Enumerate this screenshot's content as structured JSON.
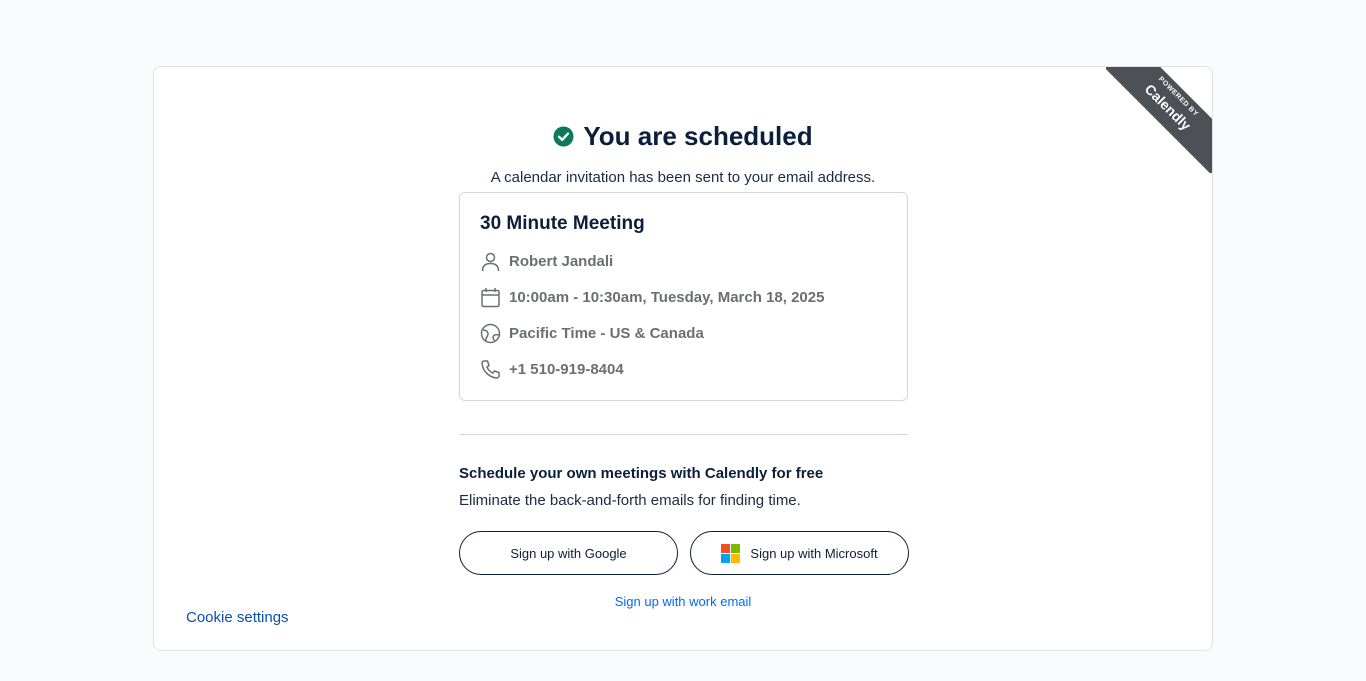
{
  "ribbon": {
    "small": "POWERED BY",
    "brand": "Calendly"
  },
  "confirmation": {
    "title": "You are scheduled",
    "subtitle": "A calendar invitation has been sent to your email address."
  },
  "event": {
    "name": "30 Minute Meeting",
    "host": "Robert Jandali",
    "datetime": "10:00am - 10:30am, Tuesday, March 18, 2025",
    "timezone": "Pacific Time - US & Canada",
    "phone": "+1 510-919-8404"
  },
  "promo": {
    "title": "Schedule your own meetings with Calendly for free",
    "subtitle": "Eliminate the back-and-forth emails for finding time.",
    "google_label": "Sign up with Google",
    "microsoft_label": "Sign up with Microsoft",
    "work_email_label": "Sign up with work email"
  },
  "footer": {
    "cookie_label": "Cookie settings"
  },
  "colors": {
    "accent": "#0069ff",
    "success": "#0a7a5a",
    "ribbon": "#4d5055",
    "text": "#0b1e3a"
  },
  "icons": {
    "check": "check-circle-icon",
    "person": "person-icon",
    "calendar": "calendar-icon",
    "globe": "globe-icon",
    "phone": "phone-icon",
    "microsoft": "microsoft-logo-icon"
  }
}
